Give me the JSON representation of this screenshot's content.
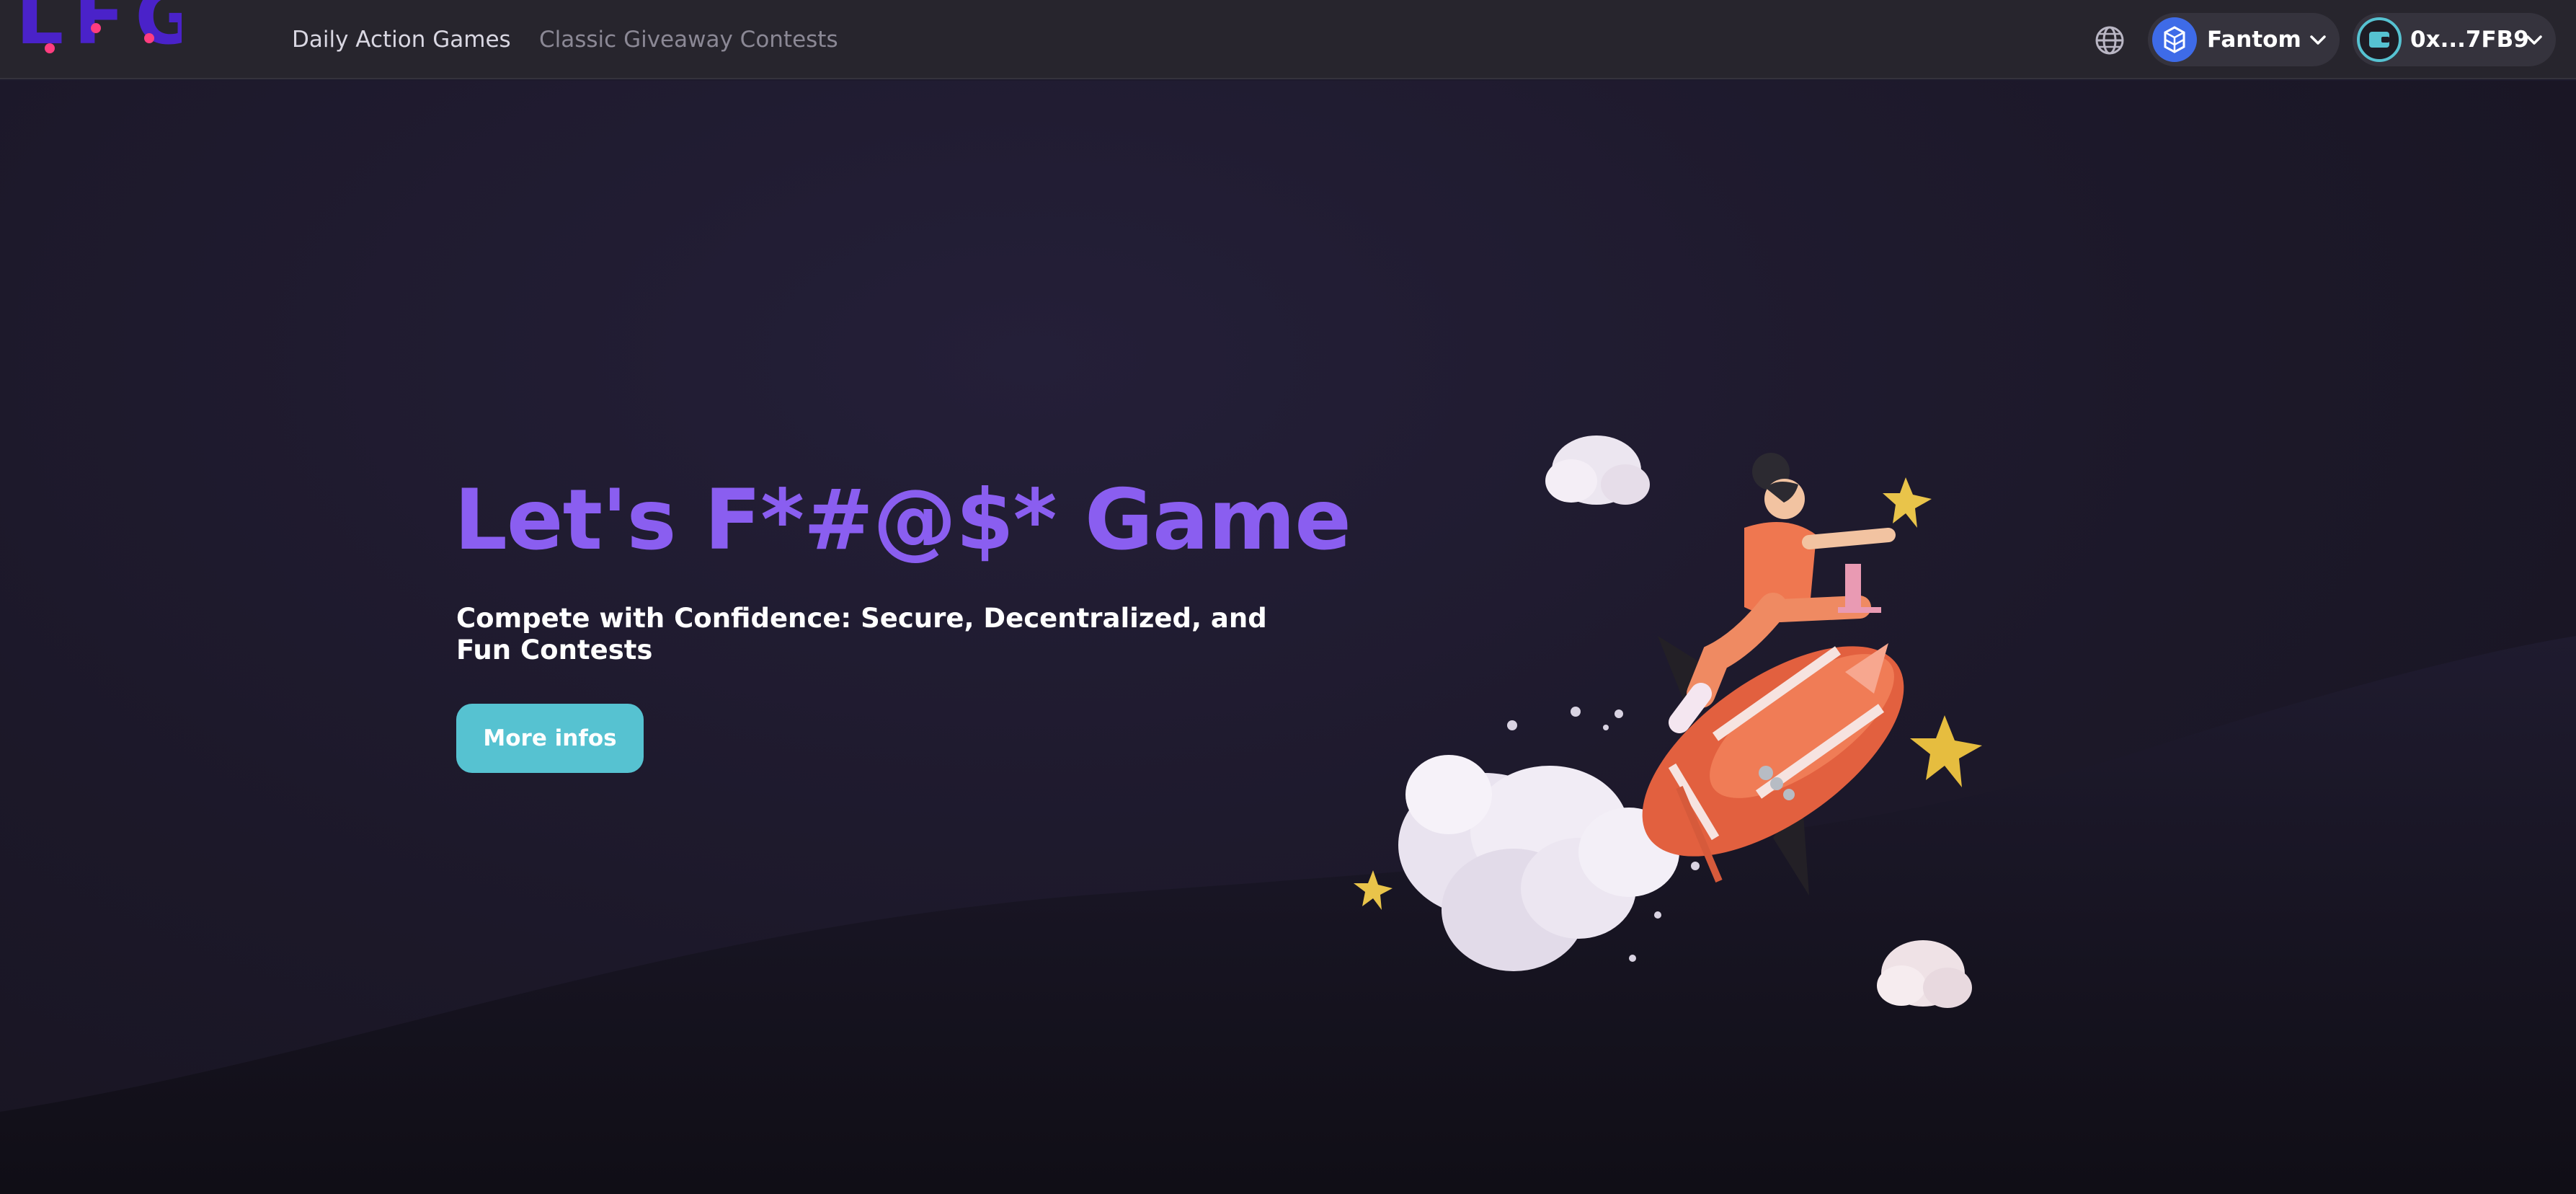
{
  "header": {
    "logo_text": "LFG",
    "nav": [
      {
        "label": "Daily Action Games",
        "active": true
      },
      {
        "label": "Classic Giveaway Contests",
        "active": false
      }
    ],
    "language_icon": "globe-icon",
    "network": {
      "label": "Fantom",
      "icon": "fantom-icon",
      "badge_color": "#3e6be8"
    },
    "wallet": {
      "label": "0x...7FB9",
      "icon": "wallet-icon",
      "badge_color": "#56c2d1"
    }
  },
  "hero": {
    "title": "Let's F*#@$* Game",
    "subtitle": "Compete with Confidence: Secure, Decentralized, and Fun Contests",
    "cta_label": "More infos",
    "illustration": "girl-riding-rocket-illustration"
  },
  "colors": {
    "title": "#8a5ef0",
    "button": "#56c2d1",
    "logo": "#4a22c9",
    "background": "#1d1a2c"
  }
}
